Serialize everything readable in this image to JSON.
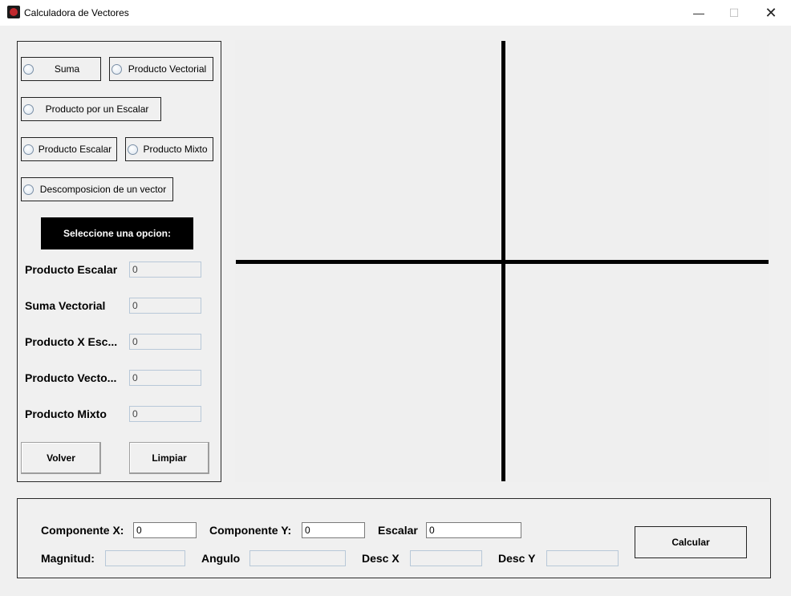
{
  "window": {
    "title": "Calculadora de Vectores",
    "minimize_glyph": "—",
    "maximize_glyph": "☐",
    "close_glyph": "✕"
  },
  "options": [
    {
      "label": "Suma"
    },
    {
      "label": "Producto Vectorial"
    },
    {
      "label": "Producto por un Escalar"
    },
    {
      "label": "Producto Escalar"
    },
    {
      "label": "Producto Mixto"
    },
    {
      "label": "Descomposicion de un vector"
    }
  ],
  "banner": "Seleccione una opcion:",
  "results": [
    {
      "label": "Producto Escalar",
      "value": "0"
    },
    {
      "label": "Suma Vectorial",
      "value": "0"
    },
    {
      "label": "Producto X Esc...",
      "value": "0"
    },
    {
      "label": "Producto Vecto...",
      "value": "0"
    },
    {
      "label": "Producto Mixto",
      "value": "0"
    }
  ],
  "buttons": {
    "back": "Volver",
    "clear": "Limpiar",
    "calculate": "Calcular"
  },
  "inputs": {
    "comp_x_label": "Componente X:",
    "comp_x_value": "0",
    "comp_y_label": "Componente Y:",
    "comp_y_value": "0",
    "scalar_label": "Escalar",
    "scalar_value": "0"
  },
  "outputs": {
    "magnitude_label": "Magnitud:",
    "magnitude_value": "",
    "angle_label": "Angulo",
    "angle_value": "",
    "desc_x_label": "Desc X",
    "desc_x_value": "",
    "desc_y_label": "Desc Y",
    "desc_y_value": ""
  }
}
